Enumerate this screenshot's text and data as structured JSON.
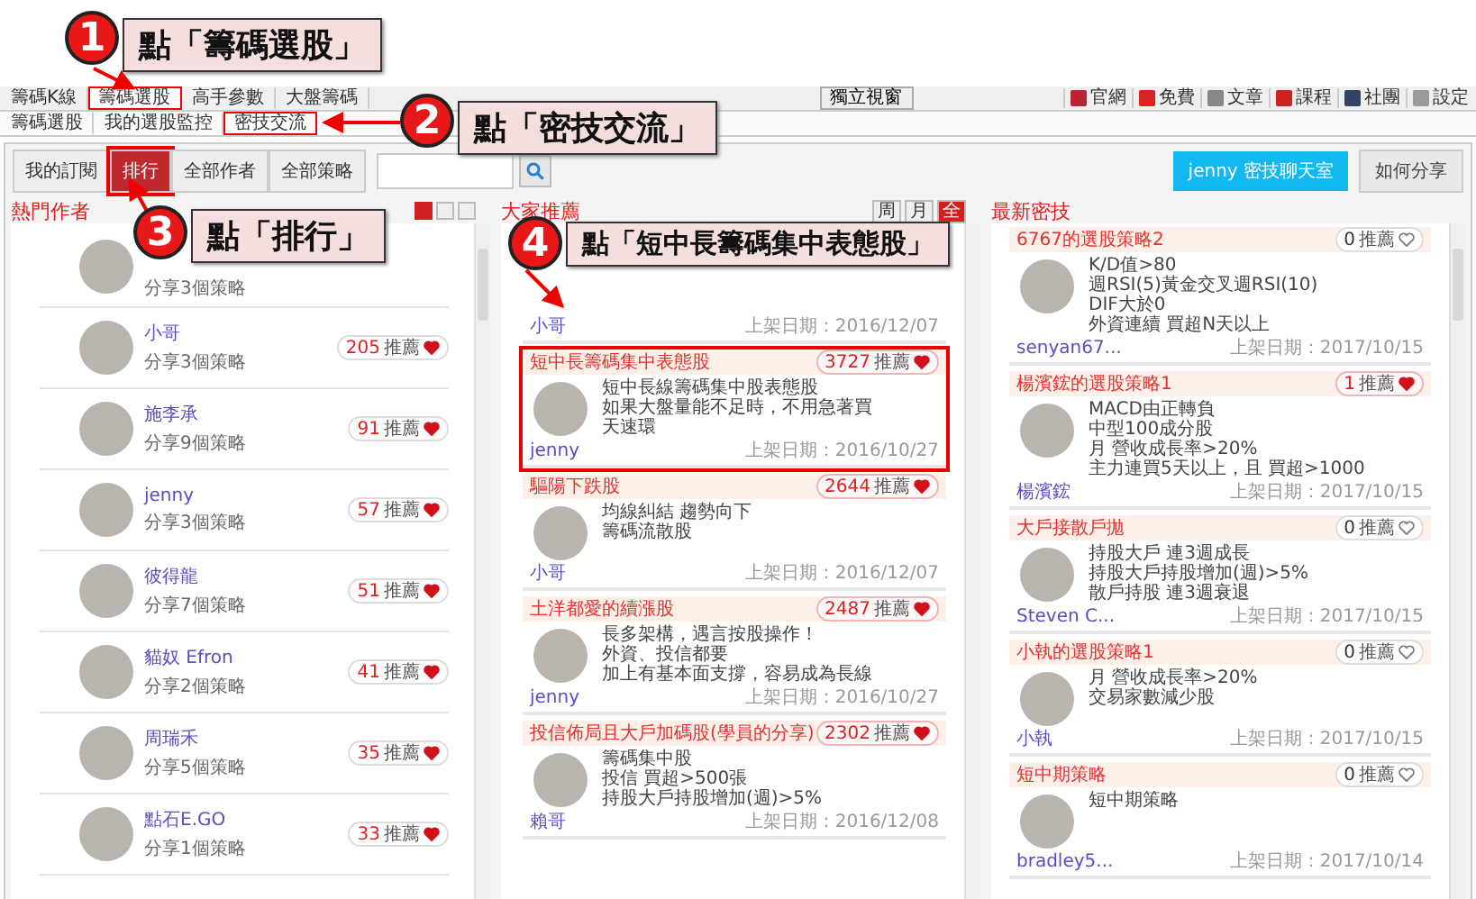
{
  "tabs_primary": [
    {
      "label": "籌碼K線",
      "selected": false
    },
    {
      "label": "籌碼選股",
      "selected": true
    },
    {
      "label": "高手參數",
      "selected": false
    },
    {
      "label": "大盤籌碼",
      "selected": false
    }
  ],
  "standalone_button": "獨立視窗",
  "top_links": [
    "官網",
    "免費",
    "文章",
    "課程",
    "社團",
    "設定"
  ],
  "tabs_secondary": [
    {
      "label": "籌碼選股",
      "selected": false
    },
    {
      "label": "我的選股監控",
      "selected": false
    },
    {
      "label": "密技交流",
      "selected": true
    }
  ],
  "view_buttons": [
    {
      "label": "我的訂閱",
      "selected": false
    },
    {
      "label": "排行",
      "selected": true
    },
    {
      "label": "全部作者",
      "selected": false
    },
    {
      "label": "全部策略",
      "selected": false
    }
  ],
  "chat_button": "jenny 密技聊天室",
  "share_button": "如何分享",
  "hot_authors": {
    "title": "熱門作者",
    "toggles": [
      {
        "selected": true
      },
      {
        "selected": false
      },
      {
        "selected": false
      }
    ],
    "items": [
      {
        "shares": "分享3個策略"
      },
      {
        "name": "小哥",
        "count": "205",
        "unit": "推薦",
        "shares": "分享3個策略"
      },
      {
        "name": "施李承",
        "count": "91",
        "unit": "推薦",
        "shares": "分享9個策略"
      },
      {
        "name": "jenny",
        "count": "57",
        "unit": "推薦",
        "shares": "分享3個策略"
      },
      {
        "name": "彼得龍",
        "count": "51",
        "unit": "推薦",
        "shares": "分享7個策略"
      },
      {
        "name": "貓奴 Efron",
        "count": "41",
        "unit": "推薦",
        "shares": "分享2個策略"
      },
      {
        "name": "周瑞禾",
        "count": "35",
        "unit": "推薦",
        "shares": "分享5個策略"
      },
      {
        "name": "點石E.GO",
        "count": "33",
        "unit": "推薦",
        "shares": "分享1個策略"
      }
    ]
  },
  "recommended": {
    "title": "大家推薦",
    "periods": [
      {
        "label": "周",
        "selected": false
      },
      {
        "label": "月",
        "selected": false
      },
      {
        "label": "全",
        "selected": true
      }
    ],
    "cards": [
      {
        "author": "小哥",
        "date": "上架日期：2016/12/07",
        "highlighted": false
      },
      {
        "title": "短中長籌碼集中表態股",
        "count": "3727",
        "unit": "推薦",
        "liked": true,
        "lines": [
          "短中長線籌碼集中股表態股",
          "如果大盤量能不足時，不用急著買",
          "天速環"
        ],
        "author": "jenny",
        "date": "上架日期：2016/10/27",
        "highlighted": true
      },
      {
        "title": "驅陽下跌股",
        "count": "2644",
        "unit": "推薦",
        "liked": true,
        "lines": [
          "均線糾結 趨勢向下",
          "籌碼流散股"
        ],
        "author": "小哥",
        "date": "上架日期：2016/12/07",
        "highlighted": false
      },
      {
        "title": "土洋都愛的續漲股",
        "count": "2487",
        "unit": "推薦",
        "liked": true,
        "lines": [
          "長多架構，遇言按股操作！",
          "外資、投信都要",
          "加上有基本面支撐，容易成為長線"
        ],
        "author": "jenny",
        "date": "上架日期：2016/10/27",
        "highlighted": false
      },
      {
        "title": "投信佈局且大戶加碼股(學員的分享)",
        "count": "2302",
        "unit": "推薦",
        "liked": true,
        "lines": [
          "籌碼集中股",
          "投信 買超>500張",
          "持股大戶持股增加(週)>5%"
        ],
        "author": "賴哥",
        "date": "上架日期：2016/12/08",
        "highlighted": false
      }
    ]
  },
  "latest": {
    "title": "最新密技",
    "cards": [
      {
        "title": "6767的選股策略2",
        "count": "0",
        "unit": "推薦",
        "liked": false,
        "lines": [
          "K/D值>80",
          "週RSI(5)黃金交叉週RSI(10)",
          "DIF大於0",
          "外資連續 買超N天以上"
        ],
        "author": "senyan67...",
        "date": "上架日期：2017/10/15",
        "highlighted": false
      },
      {
        "title": "楊濱鋐的選股策略1",
        "count": "1",
        "unit": "推薦",
        "liked": true,
        "lines": [
          "MACD由正轉負",
          "中型100成分股",
          "月 營收成長率>20%",
          "主力連買5天以上，且 買超>1000"
        ],
        "author": "楊濱鋐",
        "date": "上架日期：2017/10/15",
        "highlighted": false
      },
      {
        "title": "大戶接散戶拋",
        "count": "0",
        "unit": "推薦",
        "liked": false,
        "lines": [
          "持股大戶 連3週成長",
          "持股大戶持股增加(週)>5%",
          "散戶持股 連3週衰退"
        ],
        "author": "Steven C...",
        "date": "上架日期：2017/10/15",
        "highlighted": false
      },
      {
        "title": "小執的選股策略1",
        "count": "0",
        "unit": "推薦",
        "liked": false,
        "lines": [
          "月 營收成長率>20%",
          "交易家數減少股"
        ],
        "author": "小執",
        "date": "上架日期：2017/10/15",
        "highlighted": false
      },
      {
        "title": "短中期策略",
        "count": "0",
        "unit": "推薦",
        "liked": false,
        "lines": [
          "短中期策略"
        ],
        "author": "bradley5...",
        "date": "上架日期：2017/10/14",
        "highlighted": false
      }
    ]
  },
  "annotations": [
    {
      "number": "1",
      "text": "點「籌碼選股」"
    },
    {
      "number": "2",
      "text": "點「密技交流」"
    },
    {
      "number": "3",
      "text": "點「排行」"
    },
    {
      "number": "4",
      "text": "點「短中長籌碼集中表態股」"
    }
  ]
}
